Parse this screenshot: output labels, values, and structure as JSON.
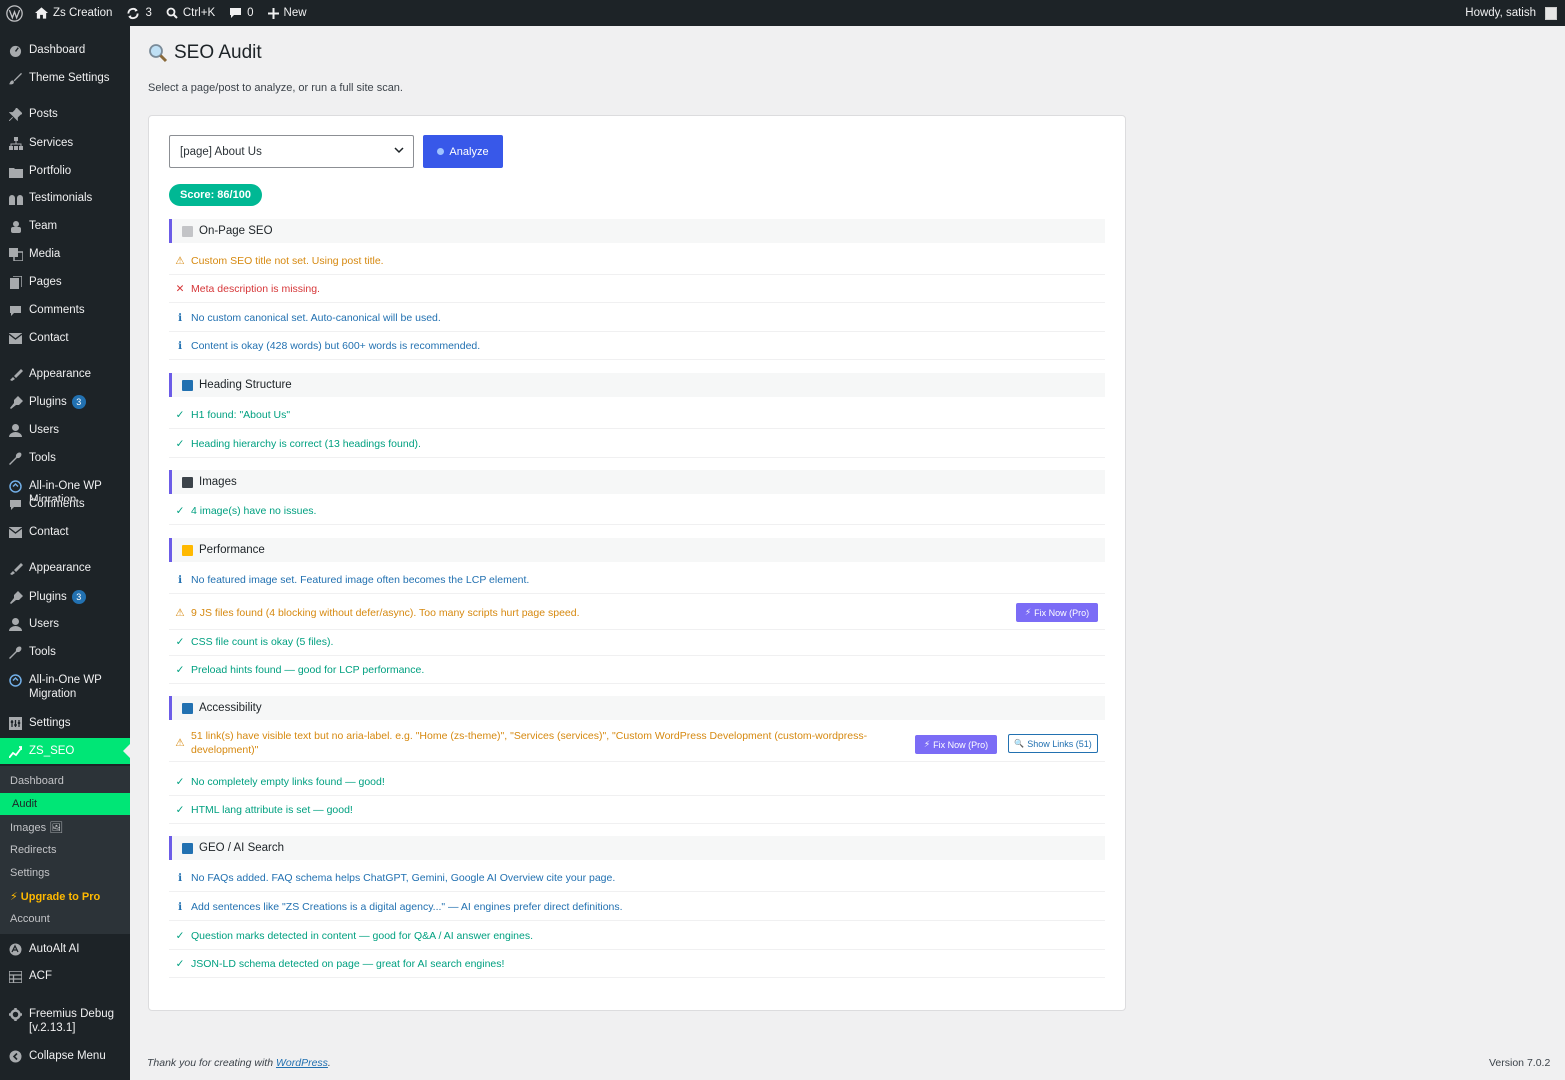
{
  "adminbar": {
    "site": "Zs Creation",
    "updates": "3",
    "search": "Ctrl+K",
    "comments": "0",
    "new": "New",
    "howdy": "Howdy, satish"
  },
  "sidebar": {
    "items": [
      {
        "label": "Dashboard",
        "icon": "dashboard-icon"
      },
      {
        "label": "Theme Settings",
        "icon": "brush-icon"
      },
      {
        "label": "Posts",
        "icon": "pin-icon"
      },
      {
        "label": "Services",
        "icon": "sitemap-icon"
      },
      {
        "label": "Portfolio",
        "icon": "portfolio-icon"
      },
      {
        "label": "Testimonials",
        "icon": "quote-icon"
      },
      {
        "label": "Team",
        "icon": "team-icon"
      },
      {
        "label": "Media",
        "icon": "media-icon"
      },
      {
        "label": "Pages",
        "icon": "pages-icon"
      },
      {
        "label": "Comments",
        "icon": "comment-icon"
      },
      {
        "label": "Contact",
        "icon": "mail-icon"
      },
      {
        "label": "Appearance",
        "icon": "appearance-icon"
      },
      {
        "label": "Plugins",
        "icon": "plugin-icon",
        "badge": "3"
      },
      {
        "label": "Users",
        "icon": "user-icon"
      },
      {
        "label": "Tools",
        "icon": "wrench-icon"
      },
      {
        "label": "All-in-One WP Migration",
        "icon": "migration-icon"
      },
      {
        "label": "Comments",
        "icon": "comment-icon"
      },
      {
        "label": "Contact",
        "icon": "mail-icon"
      },
      {
        "label": "Appearance",
        "icon": "appearance-icon"
      },
      {
        "label": "Plugins",
        "icon": "plugin-icon",
        "badge": "3"
      },
      {
        "label": "Users",
        "icon": "user-icon"
      },
      {
        "label": "Tools",
        "icon": "wrench-icon"
      },
      {
        "label": "All-in-One WP Migration",
        "icon": "migration-icon"
      },
      {
        "label": "Settings",
        "icon": "settings-icon"
      },
      {
        "label": "ZS_SEO",
        "icon": "zs-seo-icon"
      }
    ],
    "submenu": [
      {
        "label": "Dashboard"
      },
      {
        "label": "Audit"
      },
      {
        "label": "Images 🖼"
      },
      {
        "label": "Redirects"
      },
      {
        "label": "Settings"
      },
      {
        "label": "⚡ Upgrade to Pro"
      },
      {
        "label": "Account"
      }
    ],
    "bottom": [
      {
        "label": "AutoAlt AI",
        "icon": "autoalt-icon"
      },
      {
        "label": "ACF",
        "icon": "acf-icon"
      },
      {
        "label": "Freemius Debug [v.2.13.1]",
        "icon": "gear-icon"
      },
      {
        "label": "Collapse Menu",
        "icon": "collapse-icon"
      }
    ]
  },
  "page": {
    "title": "SEO Audit",
    "subtitle": "Select a page/post to analyze, or run a full site scan.",
    "selected_page": "[page] About Us",
    "analyze": "Analyze",
    "score": "Score: 86/100"
  },
  "sections": [
    {
      "title": "On-Page SEO",
      "color": "#c3c4c7",
      "rows": [
        {
          "type": "warn",
          "text": "Custom SEO title not set. Using post title."
        },
        {
          "type": "err",
          "text": "Meta description is missing."
        },
        {
          "type": "info",
          "text": "No custom canonical set. Auto-canonical will be used."
        },
        {
          "type": "info",
          "text": "Content is okay (428 words) but 600+ words is recommended."
        }
      ]
    },
    {
      "title": "Heading Structure",
      "color": "#2271b1",
      "rows": [
        {
          "type": "ok",
          "text": "H1 found: \"About Us\""
        },
        {
          "type": "ok",
          "text": "Heading hierarchy is correct (13 headings found)."
        }
      ]
    },
    {
      "title": "Images",
      "color": "#3c434a",
      "rows": [
        {
          "type": "ok",
          "text": "4 image(s) have no issues."
        }
      ]
    },
    {
      "title": "Performance",
      "color": "#ffb900",
      "rows": [
        {
          "type": "info",
          "text": "No featured image set. Featured image often becomes the LCP element."
        },
        {
          "type": "warn",
          "text": "9 JS files found (4 blocking without defer/async). Too many scripts hurt page speed.",
          "fix": "Fix Now (Pro)"
        },
        {
          "type": "ok",
          "text": "CSS file count is okay (5 files)."
        },
        {
          "type": "ok",
          "text": "Preload hints found — good for LCP performance."
        }
      ]
    },
    {
      "title": "Accessibility",
      "color": "#2271b1",
      "rows": [
        {
          "type": "warn",
          "text": "51 link(s) have visible text but no aria-label. e.g. \"Home (zs-theme)\", \"Services (services)\", \"Custom WordPress Development (custom-wordpress-development)\"",
          "fix": "Fix Now (Pro)",
          "show": "Show Links (51)"
        },
        {
          "type": "ok",
          "text": "No completely empty links found — good!"
        },
        {
          "type": "ok",
          "text": "HTML lang attribute is set — good!"
        }
      ]
    },
    {
      "title": "GEO / AI Search",
      "color": "#2271b1",
      "rows": [
        {
          "type": "info",
          "text": "No FAQs added. FAQ schema helps ChatGPT, Gemini, Google AI Overview cite your page."
        },
        {
          "type": "info",
          "text": "Add sentences like \"ZS Creations is a digital agency...\" — AI engines prefer direct definitions."
        },
        {
          "type": "ok",
          "text": "Question marks detected in content — good for Q&A / AI answer engines."
        },
        {
          "type": "ok",
          "text": "JSON-LD schema detected on page — great for AI search engines!"
        }
      ]
    }
  ],
  "footer": {
    "thanks": "Thank you for creating with",
    "wp": "WordPress",
    "version": "Version 7.0.2"
  }
}
